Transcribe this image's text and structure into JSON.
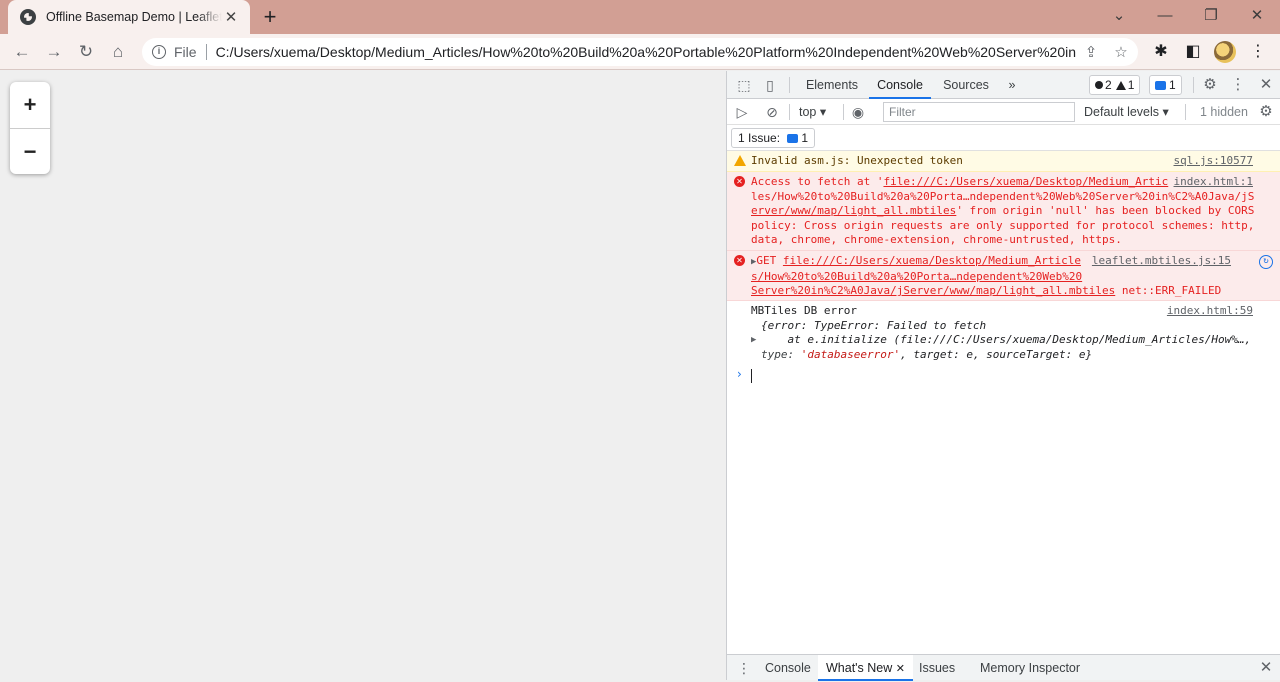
{
  "browser": {
    "tab_title": "Offline Basemap Demo | Leaflet Map",
    "tab_close": "✕",
    "new_tab": "+",
    "window_controls": {
      "minimize": "—",
      "restore": "❐",
      "close": "✕",
      "tab_search": "⌄"
    },
    "nav": {
      "back": "←",
      "forward": "→",
      "reload": "↻",
      "home": "⌂"
    },
    "address": {
      "scheme_label": "File",
      "url": "C:/Users/xuema/Desktop/Medium_Articles/How%20to%20Build%20a%20Portable%20Platform%20Independent%20Web%20Server%20in..."
    }
  },
  "map": {
    "zoom_in": "+",
    "zoom_out": "−"
  },
  "devtools": {
    "tabs": [
      "Elements",
      "Console",
      "Sources"
    ],
    "active_tab": "Console",
    "more_tabs": "»",
    "counts": {
      "errors": "2",
      "warnings": "1",
      "messages": "1"
    },
    "filterbar": {
      "context": "top",
      "filter_placeholder": "Filter",
      "levels": "Default levels",
      "hidden": "1 hidden"
    },
    "issues": {
      "label": "1 Issue:",
      "count": "1"
    },
    "console": {
      "warn": {
        "text": "Invalid asm.js: Unexpected token",
        "source": "sql.js:10577"
      },
      "error1": {
        "line1_prefix": "Access to fetch at '",
        "line1_link": "file:///C:/Users/xuema/Desktop/Medium_Artic",
        "line2": "les/How%20to%20Build%20a%20Porta…ndependent%20Web%20Server%20in%C2%A0Java/jS",
        "line3_link": "erver/www/map/light_all.mbtiles",
        "line3_rest": "' from origin 'null' has been blocked by CORS",
        "line4": "policy: Cross origin requests are only supported for protocol schemes: http,",
        "line5": "data, chrome, chrome-extension, chrome-untrusted, https.",
        "source": "index.html:1"
      },
      "error2": {
        "method": "GET",
        "line1_link": "file:///C:/Users/xuema/Desktop/Medium_Article",
        "line2": "s/How%20to%20Build%20a%20Porta…ndependent%20Web%20",
        "line3_link": "Server%20in%C2%A0Java/jServer/www/map/light_all.mbtiles",
        "line3_status": "net::ERR_FAILED",
        "source": "leaflet.mbtiles.js:15"
      },
      "log": {
        "title": "MBTiles DB error",
        "source": "index.html:59",
        "line1": "{error: TypeError: Failed to fetch",
        "line2": "    at e.initialize (file:///C:/Users/xuema/Desktop/Medium_Articles/How%…,",
        "line3_key1": "type: ",
        "line3_val1": "'databaseerror'",
        "line3_rest": ", target: e, sourceTarget: e}"
      },
      "prompt": "›"
    },
    "drawer": {
      "tabs": [
        "Console",
        "What's New",
        "Issues",
        "Memory Inspector"
      ],
      "active_tab": "What's New"
    }
  }
}
